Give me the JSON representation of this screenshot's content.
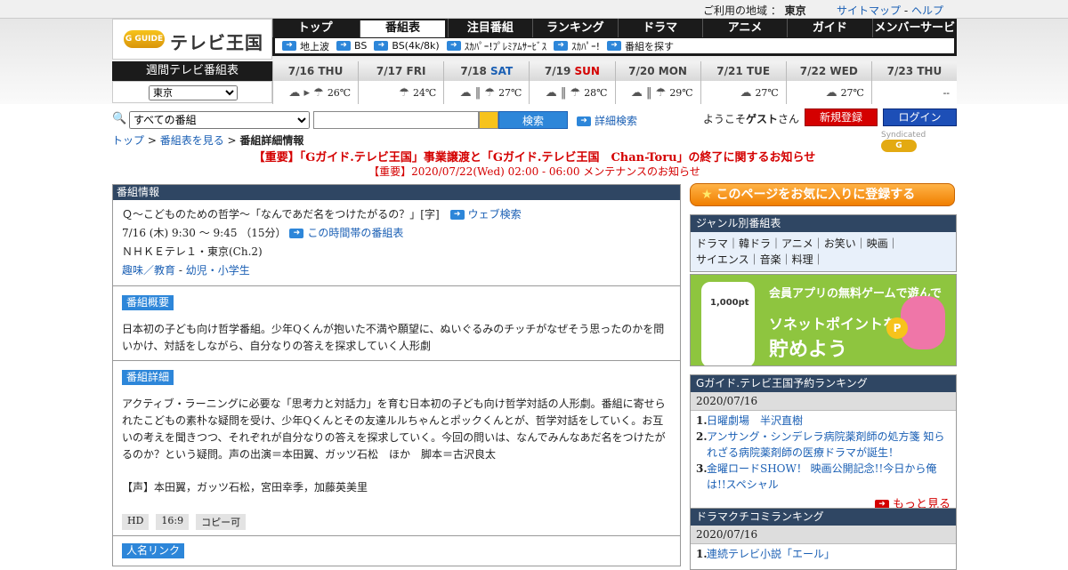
{
  "topbar": {
    "region_label": "ご利用の地域 ：",
    "region_value": "東京",
    "sitemap": "サイトマップ",
    "sep": "-",
    "help": "ヘルプ"
  },
  "logo": {
    "badge": "G GUIDE",
    "title": "テレビ王国"
  },
  "nav": {
    "tabs": [
      "トップ",
      "番組表",
      "注目番組",
      "ランキング",
      "ドラマ",
      "アニメ",
      "ガイド",
      "メンバーサービス"
    ],
    "sub": [
      "地上波",
      "BS",
      "BS(4k/8k)",
      "ｽｶﾊﾟｰ!ﾌﾟﾚﾐｱﾑｻｰﾋﾞｽ",
      "ｽｶﾊﾟｰ!",
      "番組を探す"
    ]
  },
  "week": {
    "title": "週間テレビ番組表",
    "area": "東京",
    "days": [
      {
        "label": "7/16",
        "dow": "THU",
        "kind": "",
        "weather": "☁ ▸ ☂",
        "temp": "26℃"
      },
      {
        "label": "7/17",
        "dow": "FRI",
        "kind": "",
        "weather": "☂",
        "temp": "24℃"
      },
      {
        "label": "7/18",
        "dow": "SAT",
        "kind": "sat",
        "weather": "☁ ‖ ☂",
        "temp": "27℃"
      },
      {
        "label": "7/19",
        "dow": "SUN",
        "kind": "sun",
        "weather": "☁ ‖ ☂",
        "temp": "28℃"
      },
      {
        "label": "7/20",
        "dow": "MON",
        "kind": "",
        "weather": "☁ ‖ ☂",
        "temp": "29℃"
      },
      {
        "label": "7/21",
        "dow": "TUE",
        "kind": "",
        "weather": "☁",
        "temp": "27℃"
      },
      {
        "label": "7/22",
        "dow": "WED",
        "kind": "",
        "weather": "☁",
        "temp": "27℃"
      },
      {
        "label": "7/23",
        "dow": "THU",
        "kind": "",
        "weather": "",
        "temp": "--"
      }
    ]
  },
  "search": {
    "category": "すべての番組",
    "button": "検索",
    "advanced": "詳細検索",
    "welcome": "ようこそ",
    "guest": "ゲスト",
    "san": "さん",
    "register": "新規登録",
    "login": "ログイン"
  },
  "breadcrumb": {
    "top": "トップ",
    "sep": " > ",
    "schedule": "番組表を見る",
    "current": "番組詳細情報"
  },
  "syndicated": "Syndicated",
  "notices": [
    "【重要】「Gガイド.テレビ王国」事業譲渡と「Gガイド.テレビ王国　Chan-Toru」の終了に関するお知らせ",
    "【重要】2020/07/22(Wed) 02:00 - 06:00 メンテナンスのお知らせ"
  ],
  "program": {
    "header": "番組情報",
    "title": "Ｑ～こどものための哲学～「なんであだ名をつけたがるの？」[字]",
    "web_search": "ウェブ検索",
    "time": "7/16 (木) 9:30 ～ 9:45 （15分）",
    "same_time": "この時間帯の番組表",
    "channel": "ＮＨＫＥテレ１・東京(Ch.2)",
    "genre1": "趣味／教育",
    "genre_sep": " - ",
    "genre2": "幼児・小学生",
    "summary_label": "番組概要",
    "summary": "日本初の子ども向け哲学番組。少年Qくんが抱いた不満や願望に、ぬいぐるみのチッチがなぜそう思ったのかを問いかけ、対話をしながら、自分なりの答えを探求していく人形劇",
    "detail_label": "番組詳細",
    "detail": "アクティブ・ラーニングに必要な「思考力と対話力」を育む日本初の子ども向け哲学対話の人形劇。番組に寄せられたこどもの素朴な疑問を受け、少年Qくんとその友達ルルちゃんとポックくんとが、哲学対話をしていく。お互いの考えを聞きつつ、それぞれが自分なりの答えを探求していく。今回の問いは、なんでみんなあだ名をつけたがるのか？という疑問。声の出演＝本田翼、ガッツ石松　ほか　脚本＝古沢良太",
    "cast": "【声】本田翼，ガッツ石松，宮田幸季，加藤英美里",
    "tags": [
      "HD",
      "16:9",
      "コピー可"
    ],
    "next_label": "人名リンク"
  },
  "right": {
    "favorite": "このページをお気に入りに登録する",
    "genre_title": "ジャンル別番組表",
    "genres": "ドラマ｜韓ドラ｜アニメ｜お笑い｜映画｜",
    "genres2": "サイエンス｜音楽｜料理｜",
    "ad": {
      "line1": "会員アプリの無料ゲームで遊んで",
      "line2": "ソネットポイントを",
      "line3": "貯めよう",
      "pt": "1,000pt",
      "coin": "P"
    },
    "ranking1": {
      "title": "Gガイド.テレビ王国予約ランキング",
      "date": "2020/07/16",
      "items": [
        "日曜劇場　半沢直樹",
        "アンサング・シンデレラ病院薬剤師の処方箋 知られざる病院薬剤師の医療ドラマが誕生！",
        "金曜ロードSHOW！ 映画公開記念!!今日から俺は!!スペシャル"
      ],
      "more": "もっと見る"
    },
    "ranking2": {
      "title": "ドラマクチコミランキング",
      "date": "2020/07/16",
      "items": [
        "連続テレビ小説「エール」"
      ]
    }
  }
}
